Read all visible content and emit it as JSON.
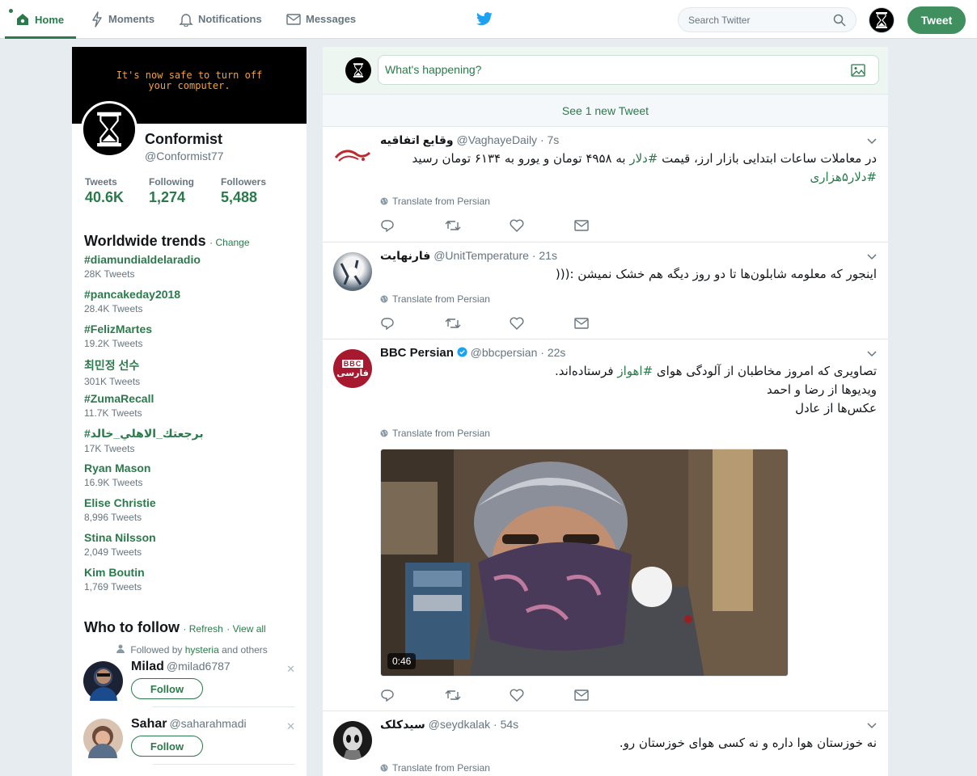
{
  "nav": {
    "home": "Home",
    "moments": "Moments",
    "notifications": "Notifications",
    "messages": "Messages",
    "search_placeholder": "Search Twitter",
    "tweet_button": "Tweet"
  },
  "profile": {
    "banner_text": "It's now safe to turn off\nyour computer.",
    "name": "Conformist",
    "handle": "@Conformist77",
    "stats": [
      {
        "label": "Tweets",
        "value": "40.6K"
      },
      {
        "label": "Following",
        "value": "1,274"
      },
      {
        "label": "Followers",
        "value": "5,488"
      }
    ]
  },
  "trends": {
    "title": "Worldwide trends",
    "change": "Change",
    "items": [
      {
        "name": "#diamundialdelaradio",
        "count": "28K Tweets"
      },
      {
        "name": "#pancakeday2018",
        "count": "28.4K Tweets"
      },
      {
        "name": "#FelizMartes",
        "count": "19.2K Tweets"
      },
      {
        "name": "최민정 선수",
        "count": "301K Tweets"
      },
      {
        "name": "#ZumaRecall",
        "count": "11.7K Tweets"
      },
      {
        "name": "#برجعتك_الاهلي_خالد",
        "count": "17K Tweets"
      },
      {
        "name": "Ryan Mason",
        "count": "16.9K Tweets"
      },
      {
        "name": "Elise Christie",
        "count": "8,996 Tweets"
      },
      {
        "name": "Stina Nilsson",
        "count": "2,049 Tweets"
      },
      {
        "name": "Kim Boutin",
        "count": "1,769 Tweets"
      }
    ]
  },
  "who_to_follow": {
    "title": "Who to follow",
    "refresh": "Refresh",
    "view_all": "View all",
    "followed_by_prefix": "Followed by",
    "followed_by_user": "hysteria",
    "followed_by_suffix": "and others",
    "users": [
      {
        "name": "Milad",
        "handle": "@milad6787",
        "button": "Follow"
      },
      {
        "name": "Sahar",
        "handle": "@saharahmadi",
        "button": "Follow"
      }
    ]
  },
  "compose": {
    "placeholder": "What's happening?",
    "new_tweets": "See 1 new Tweet"
  },
  "tweets": [
    {
      "name": "وقايع اتفاقيه",
      "handle": "@VaghayeDaily",
      "time": "7s",
      "line1_pre": "در معاملات ساعات ابتدایی بازار ارز، قیمت ",
      "line1_tag": "#دلار",
      "line1_post": " به ۴۹۵۸ تومان و یورو به ۶۱۳۴ تومان رسید",
      "line2_tag": "#دلار۵هزاری",
      "translate": "Translate from Persian"
    },
    {
      "name": "فارنهایت",
      "handle": "@UnitTemperature",
      "time": "21s",
      "line1": "اینجور که معلومه شابلون‌ها تا دو روز دیگه هم خشک نمیشن :(((",
      "translate": "Translate from Persian"
    },
    {
      "name": "BBC Persian",
      "handle": "@bbcpersian",
      "time": "22s",
      "line1_pre": "تصاویری که امروز مخاطبان از آلودگی هوای ",
      "line1_tag": "#اهواز",
      "line1_post": " فرستاده‌اند.",
      "line2": "ویدیوها از رضا و احمد",
      "line3": "عکس‌ها از عادل",
      "translate": "Translate from Persian",
      "video_duration": "0:46",
      "avatar_top": "BBC",
      "avatar_bottom": "فارسی"
    },
    {
      "name": "سیدکلک",
      "handle": "@seydkalak",
      "time": "54s",
      "line1": "نه خوزستان هوا داره و نه کسی هوای خوزستان رو.",
      "translate": "Translate from Persian"
    }
  ],
  "colors": {
    "accent": "#2b7a4b",
    "tweet_button": "#3f8f5f",
    "twitter_blue": "#1da1f2"
  }
}
